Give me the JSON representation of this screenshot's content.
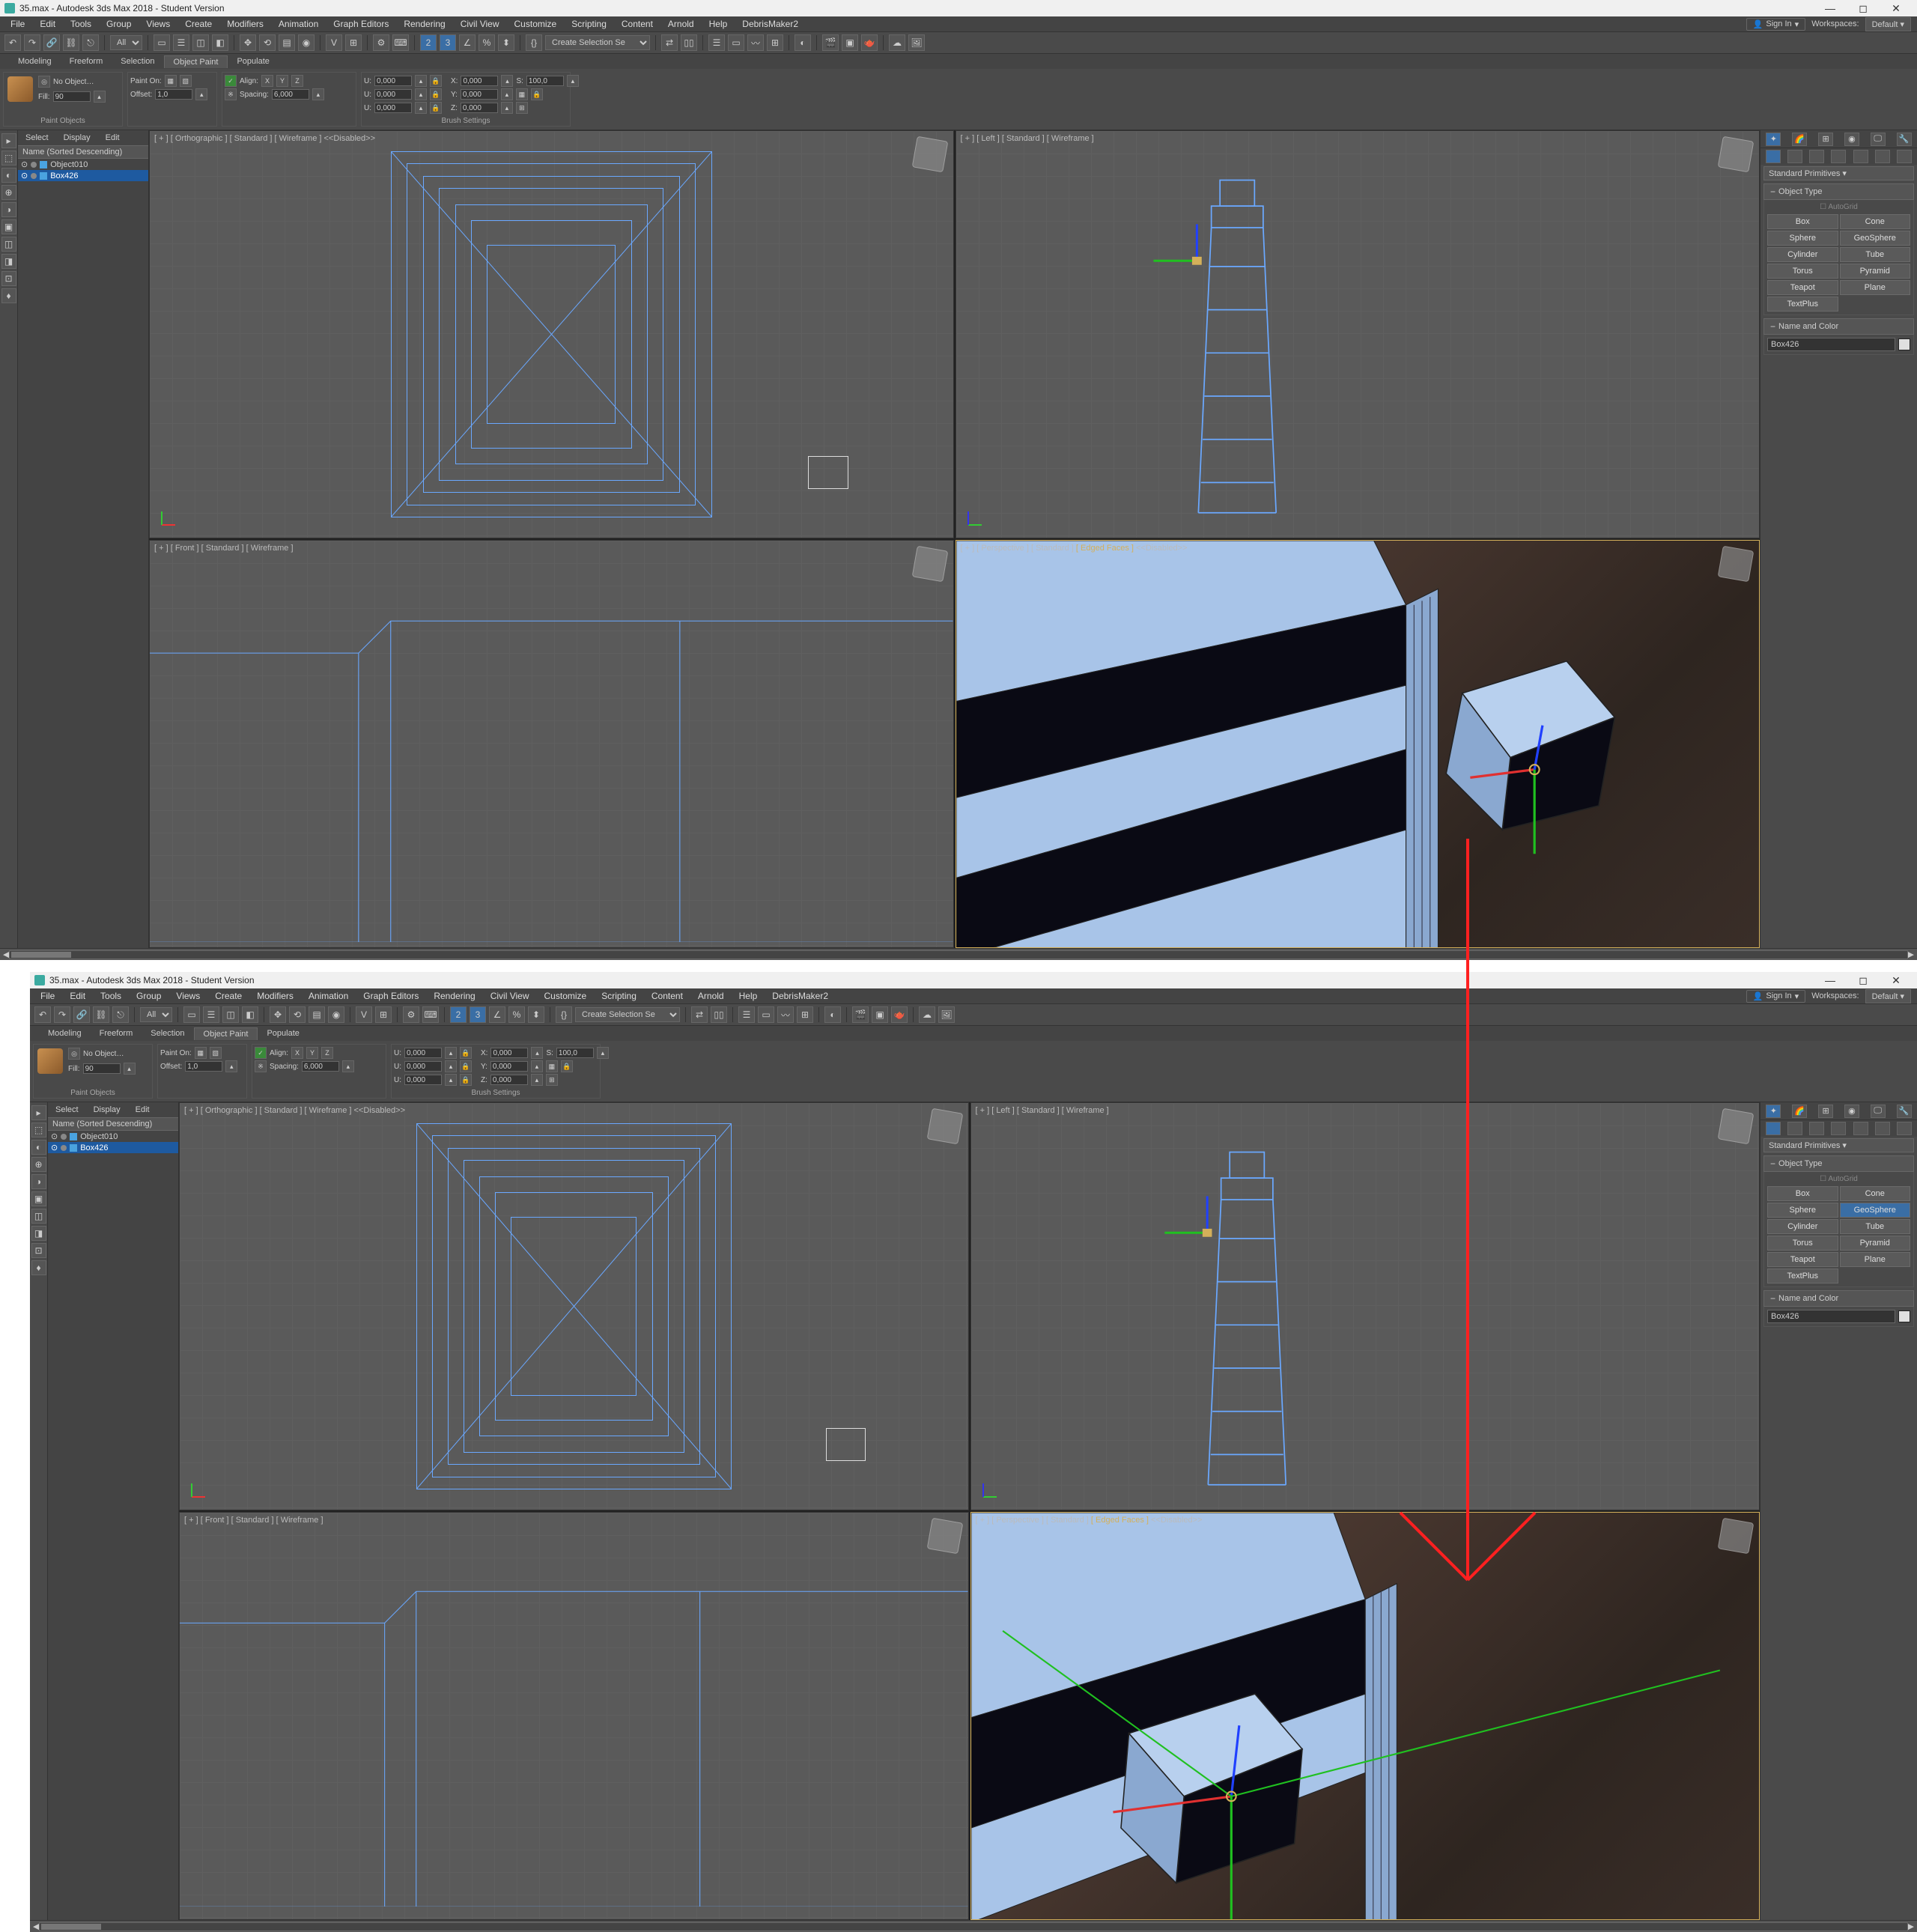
{
  "app": {
    "title": "35.max - Autodesk 3ds Max 2018 - Student Version",
    "signin": "Sign In",
    "workspaces_label": "Workspaces:",
    "workspaces_value": "Default"
  },
  "menu": [
    "File",
    "Edit",
    "Tools",
    "Group",
    "Views",
    "Create",
    "Modifiers",
    "Animation",
    "Graph Editors",
    "Rendering",
    "Civil View",
    "Customize",
    "Scripting",
    "Content",
    "Arnold",
    "Help",
    "DebrisMaker2"
  ],
  "toolbar": {
    "all_label": "All",
    "selset_label": "Create Selection Se"
  },
  "ribbon": {
    "tabs": [
      "Modeling",
      "Freeform",
      "Selection",
      "Object Paint",
      "Populate"
    ],
    "active_tab": "Object Paint",
    "paint_objects": "Paint Objects",
    "no_objects": "No Object…",
    "fill": "Fill:",
    "fill_val": "90",
    "paint_on": "Paint On:",
    "offset": "Offset:",
    "offset_val": "1,0",
    "align": "Align:",
    "spacing": "Spacing:",
    "spacing_val": "6,000",
    "brush_settings": "Brush Settings",
    "x_label": "X:",
    "y_label": "Y:",
    "z_label": "Z:",
    "u_label": "U:",
    "s_label": "S:",
    "val_000": "0,000",
    "val_100": "100,0"
  },
  "scene": {
    "tabs": [
      "Select",
      "Display",
      "Edit"
    ],
    "header": "Name (Sorted Descending)",
    "items": [
      {
        "name": "Object010",
        "sel": false
      },
      {
        "name": "Box426",
        "sel": true
      }
    ]
  },
  "viewports": {
    "top": "[ + ] [ Orthographic ] [ Standard ] [ Wireframe ]  <<Disabled>>",
    "left": "[ + ] [ Left ] [ Standard ] [ Wireframe ]",
    "front": "[ + ] [ Front ] [ Standard ] [ Wireframe ]",
    "persp_pre": "[ + ] [ Perspective ] [ Standard ] ",
    "persp_hl": "[ Edged Faces ]",
    "persp_post": "  <<Disabled>>"
  },
  "right_panel": {
    "dropdown": "Standard Primitives",
    "rollout_objtype": "Object Type",
    "autogrid": "AutoGrid",
    "objects": [
      "Box",
      "Cone",
      "Sphere",
      "GeoSphere",
      "Cylinder",
      "Tube",
      "Torus",
      "Pyramid",
      "Teapot",
      "Plane",
      "TextPlus"
    ],
    "rollout_namecolor": "Name and Color",
    "obj_name": "Box426"
  },
  "second": {
    "right_panel_objects_sel": "GeoSphere"
  }
}
